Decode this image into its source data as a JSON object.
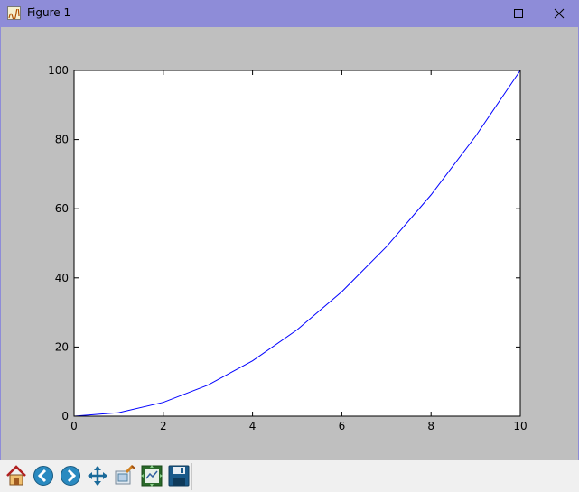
{
  "window": {
    "title": "Figure 1",
    "colors": {
      "titlebar": "#8e8cd8",
      "canvas": "#bfbfbf",
      "toolbar": "#f0f0f0"
    }
  },
  "toolbar": {
    "buttons": [
      {
        "name": "home-button",
        "icon": "home-icon"
      },
      {
        "name": "back-button",
        "icon": "arrow-left-icon"
      },
      {
        "name": "forward-button",
        "icon": "arrow-right-icon"
      },
      {
        "name": "pan-button",
        "icon": "move-icon"
      },
      {
        "name": "zoom-button",
        "icon": "zoom-rect-icon"
      },
      {
        "name": "subplots-button",
        "icon": "subplots-icon"
      },
      {
        "name": "save-button",
        "icon": "save-icon"
      }
    ]
  },
  "chart_data": {
    "type": "line",
    "x": [
      0,
      1,
      2,
      3,
      4,
      5,
      6,
      7,
      8,
      9,
      10
    ],
    "series": [
      {
        "values": [
          0,
          1,
          4,
          9,
          16,
          25,
          36,
          49,
          64,
          81,
          100
        ],
        "color": "#0000ff"
      }
    ],
    "xlim": [
      0,
      10
    ],
    "ylim": [
      0,
      100
    ],
    "xticks": [
      "0",
      "2",
      "4",
      "6",
      "8",
      "10"
    ],
    "yticks": [
      "0",
      "20",
      "40",
      "60",
      "80",
      "100"
    ],
    "title": "",
    "xlabel": "",
    "ylabel": "",
    "grid": false
  }
}
